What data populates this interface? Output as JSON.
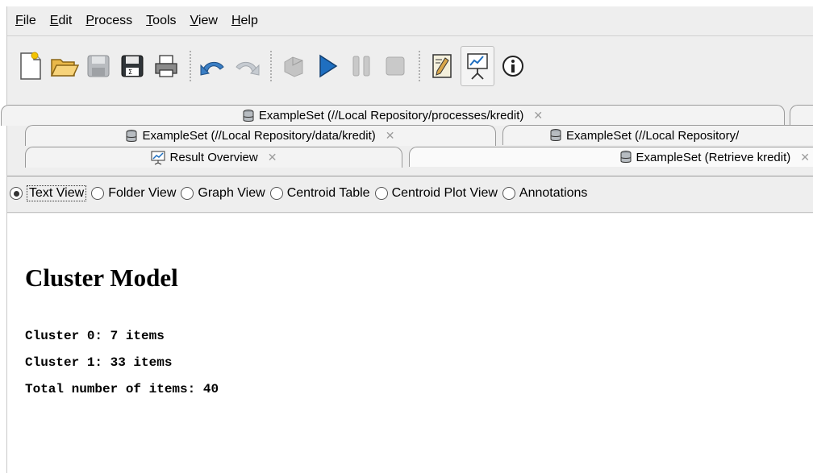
{
  "menu": {
    "items": [
      {
        "key": "F",
        "rest": "ile"
      },
      {
        "key": "E",
        "rest": "dit"
      },
      {
        "key": "P",
        "rest": "rocess"
      },
      {
        "key": "T",
        "rest": "ools"
      },
      {
        "key": "V",
        "rest": "iew"
      },
      {
        "key": "H",
        "rest": "elp"
      }
    ]
  },
  "toolbar": {
    "icons": [
      "new-process-icon",
      "open-folder-icon",
      "save-icon",
      "save-as-icon",
      "print-icon",
      "undo-icon",
      "redo-icon",
      "validate-icon",
      "run-icon",
      "pause-icon",
      "stop-icon",
      "design-perspective-icon",
      "result-perspective-icon",
      "info-icon"
    ]
  },
  "tabs": {
    "row1": {
      "label": "ExampleSet (//Local Repository/processes/kredit)"
    },
    "row2_left": {
      "label": "ExampleSet (//Local Repository/data/kredit)"
    },
    "row2_right": {
      "label": "ExampleSet (//Local Repository/"
    },
    "row3_left": {
      "label": "Result Overview"
    },
    "row3_right": {
      "label": "ExampleSet (Retrieve kredit)"
    },
    "close_glyph": "✕"
  },
  "views": {
    "selected": "Text View",
    "options": [
      "Text View",
      "Folder View",
      "Graph View",
      "Centroid Table",
      "Centroid Plot View",
      "Annotations"
    ]
  },
  "content": {
    "title": "Cluster Model",
    "lines": [
      "Cluster 0: 7 items",
      "Cluster 1: 33 items",
      "Total number of items: 40"
    ]
  },
  "colors": {
    "background": "#eeeeee",
    "run_blue": "#1f6fc0",
    "disabled_gray": "#b8b8b8"
  }
}
